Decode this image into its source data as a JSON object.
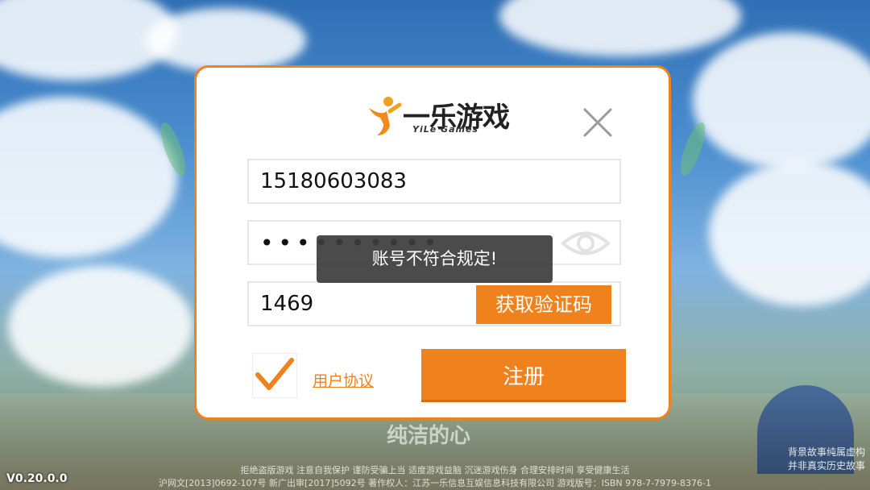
{
  "app": {
    "logo_cn": "一乐游戏",
    "logo_en": "YiLe Games"
  },
  "form": {
    "phone_value": "15180603083",
    "password_mask": "••••••••••",
    "code_value": "1469",
    "get_code_label": "获取验证码",
    "agreement_label": "用户协议",
    "agreement_checked": true,
    "register_label": "注册"
  },
  "toast": {
    "message": "账号不符合规定!"
  },
  "background": {
    "version": "V0.20.0.0",
    "caption": "纯洁的心",
    "footer_line1": "拒绝盗版游戏 注意自我保护 谨防受骗上当 适度游戏益脑 沉迷游戏伤身 合理安排时间 享受健康生活",
    "footer_line2": "沪网文[2013]0692-107号   新广出审[2017]5092号 著作权人：江苏一乐信息互娱信息科技有限公司 游戏版号：ISBN 978-7-7979-8376-1",
    "footer_right_line1": "背景故事纯属虚构",
    "footer_right_line2": "并非真实历史故事"
  },
  "colors": {
    "accent": "#f0821e",
    "toast_bg": "#3c3c3c"
  },
  "icons": {
    "close": "close-icon",
    "eye": "eye-icon",
    "check": "checkmark-icon",
    "logo": "yile-logo-mark"
  }
}
